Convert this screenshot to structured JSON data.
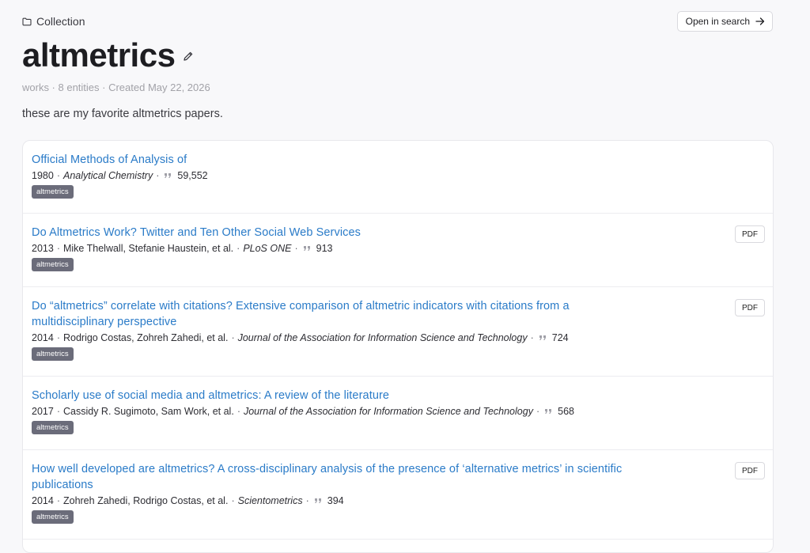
{
  "breadcrumb": {
    "label": "Collection",
    "icon": "folder-icon"
  },
  "actions": {
    "open_in_search": "Open in search"
  },
  "collection": {
    "title": "altmetrics",
    "meta": "works · 8 entities · Created May 22, 2026",
    "description": "these are my favorite altmetrics papers."
  },
  "works": [
    {
      "title": "Official Methods of Analysis of",
      "year": "1980",
      "authors": "",
      "venue": "Analytical Chemistry",
      "citations": "59,552",
      "tag": "altmetrics",
      "pdf": ""
    },
    {
      "title": "Do Altmetrics Work? Twitter and Ten Other Social Web Services",
      "year": "2013",
      "authors": "Mike Thelwall, Stefanie Haustein, et al.",
      "venue": "PLoS ONE",
      "citations": "913",
      "tag": "altmetrics",
      "pdf": "PDF"
    },
    {
      "title": "Do “altmetrics” correlate with citations? Extensive comparison of altmetric indicators with citations from a multidisciplinary perspective",
      "year": "2014",
      "authors": "Rodrigo Costas, Zohreh Zahedi, et al.",
      "venue": "Journal of the Association for Information Science and Technology",
      "citations": "724",
      "tag": "altmetrics",
      "pdf": "PDF"
    },
    {
      "title": "Scholarly use of social media and altmetrics: A review of the literature",
      "year": "2017",
      "authors": "Cassidy R. Sugimoto, Sam Work, et al.",
      "venue": "Journal of the Association for Information Science and Technology",
      "citations": "568",
      "tag": "altmetrics",
      "pdf": ""
    },
    {
      "title": "How well developed are altmetrics? A cross-disciplinary analysis of the presence of ‘alternative metrics’ in scientific publications",
      "year": "2014",
      "authors": "Zohreh Zahedi, Rodrigo Costas, et al.",
      "venue": "Scientometrics",
      "citations": "394",
      "tag": "altmetrics",
      "pdf": "PDF"
    }
  ]
}
